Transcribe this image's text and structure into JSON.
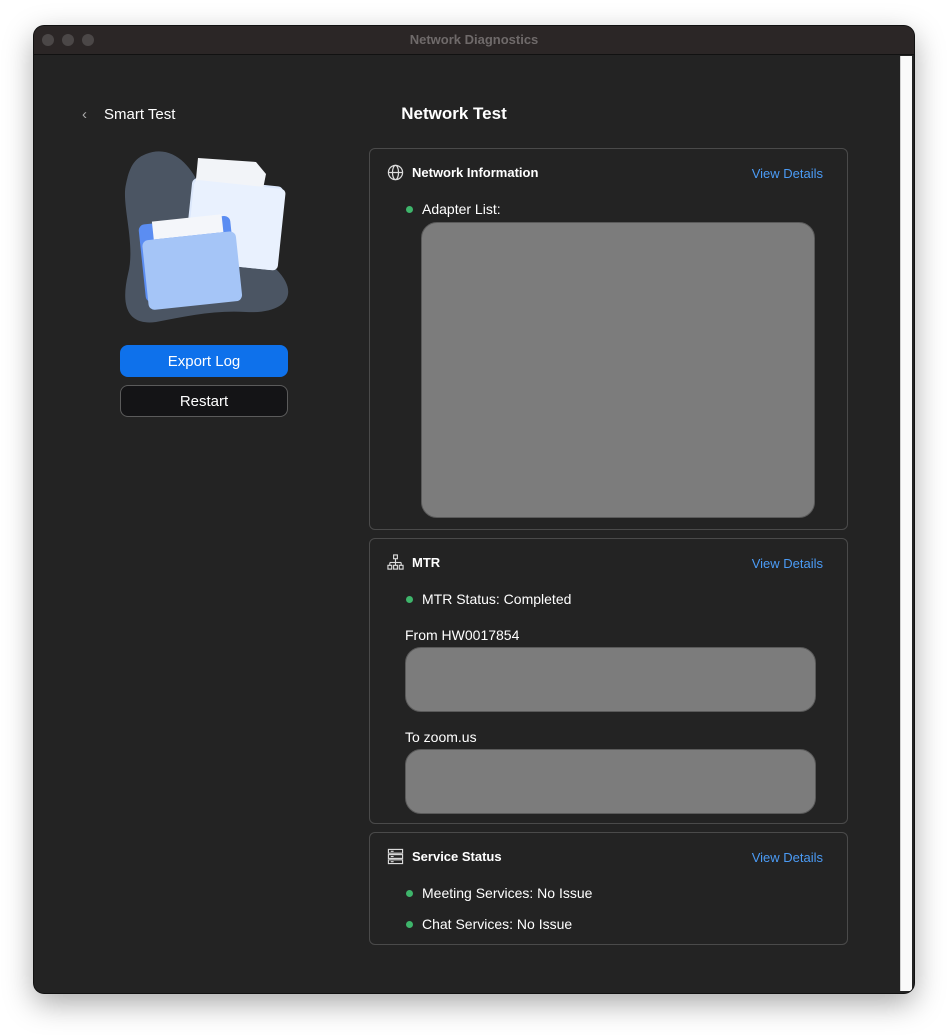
{
  "window": {
    "title": "Network Diagnostics"
  },
  "sidebar": {
    "back_label": "Smart Test",
    "export_label": "Export Log",
    "restart_label": "Restart"
  },
  "main": {
    "title": "Network Test",
    "network_info": {
      "title": "Network Information",
      "view_details": "View Details",
      "adapter_label": "Adapter List:"
    },
    "mtr": {
      "title": "MTR",
      "view_details": "View Details",
      "status": "MTR Status: Completed",
      "from_label": "From HW0017854",
      "to_label": "To zoom.us"
    },
    "service_status": {
      "title": "Service Status",
      "view_details": "View Details",
      "items": [
        "Meeting Services: No Issue",
        "Chat Services: No Issue"
      ]
    }
  },
  "colors": {
    "accent": "#0e71eb",
    "link": "#4b9bf5",
    "status_ok": "#3eb56b",
    "background": "#232323"
  }
}
